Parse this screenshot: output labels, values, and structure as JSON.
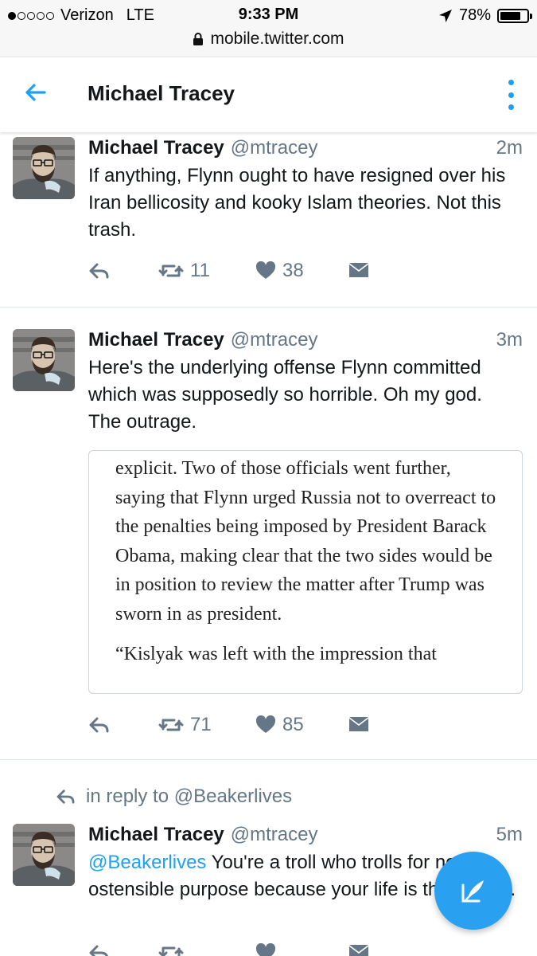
{
  "status_bar": {
    "carrier": "Verizon",
    "network": "LTE",
    "time": "9:33 PM",
    "battery": "78%",
    "battery_level": 0.78,
    "url": "mobile.twitter.com"
  },
  "header": {
    "title": "Michael Tracey",
    "accent_color": "#1da1f2"
  },
  "tweets": [
    {
      "name": "Michael Tracey",
      "handle": "@mtracey",
      "time": "2m",
      "text": "If anything, Flynn ought to have resigned over his Iran bellicosity and kooky Islam theories. Not this trash.",
      "retweets": "11",
      "likes": "38"
    },
    {
      "name": "Michael Tracey",
      "handle": "@mtracey",
      "time": "3m",
      "text": "Here's the underlying offense Flynn committed which was supposedly so horrible. Oh my god. The outrage.",
      "quote_paragraph_1": "explicit. Two of those officials went further, saying that Flynn urged Russia not to overreact to the penalties being imposed by President Barack Obama, making clear that the two sides would be in position to review the matter after Trump was sworn in as president.",
      "quote_paragraph_2": "“Kislyak was left with the impression that",
      "retweets": "71",
      "likes": "85"
    },
    {
      "reply_context": "in reply to @Beakerlives",
      "name": "Michael Tracey",
      "handle": "@mtracey",
      "time": "5m",
      "mention": "@Beakerlives",
      "text": " You're a troll who trolls for no ostensible purpose because your life is that empty."
    }
  ],
  "icons": {
    "back": "arrow-left-icon",
    "more": "vertical-dots-icon",
    "reply": "reply-icon",
    "retweet": "retweet-icon",
    "like": "heart-icon",
    "dm": "envelope-icon",
    "compose": "compose-feather-icon"
  }
}
